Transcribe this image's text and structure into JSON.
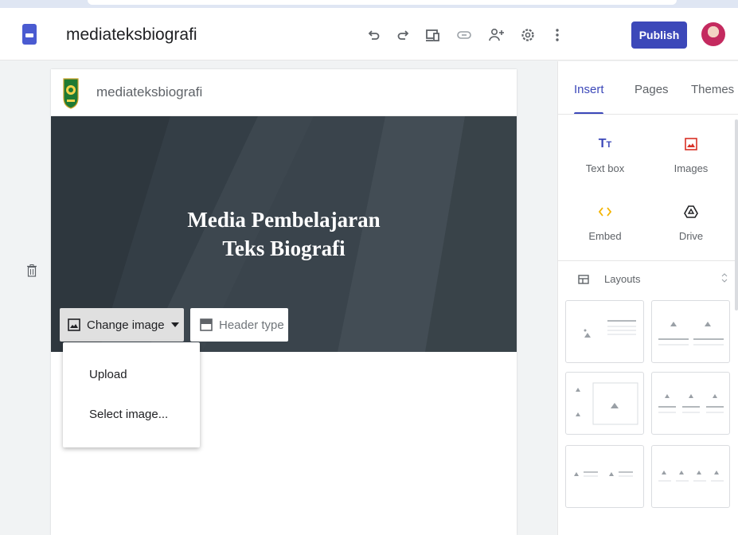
{
  "app": {
    "title": "mediateksbiografi",
    "publish_label": "Publish"
  },
  "site": {
    "name": "mediateksbiografi",
    "hero_title_line1": "Media Pembelajaran",
    "hero_title_line2": "Teks Biografi"
  },
  "header_toolbar": {
    "change_image_label": "Change image",
    "header_type_label": "Header type"
  },
  "dropdown": {
    "items": [
      "Upload",
      "Select image..."
    ]
  },
  "sidebar": {
    "tabs": [
      "Insert",
      "Pages",
      "Themes"
    ],
    "active_tab": "Insert",
    "insert_items": [
      "Text box",
      "Images",
      "Embed",
      "Drive"
    ],
    "layouts_label": "Layouts"
  },
  "colors": {
    "accent": "#3c48b9",
    "image_icon": "#d93025",
    "embed_icon": "#f4b400"
  },
  "icons": [
    "undo-icon",
    "redo-icon",
    "preview-icon",
    "link-icon",
    "share-icon",
    "settings-icon",
    "more-icon",
    "trash-icon"
  ]
}
